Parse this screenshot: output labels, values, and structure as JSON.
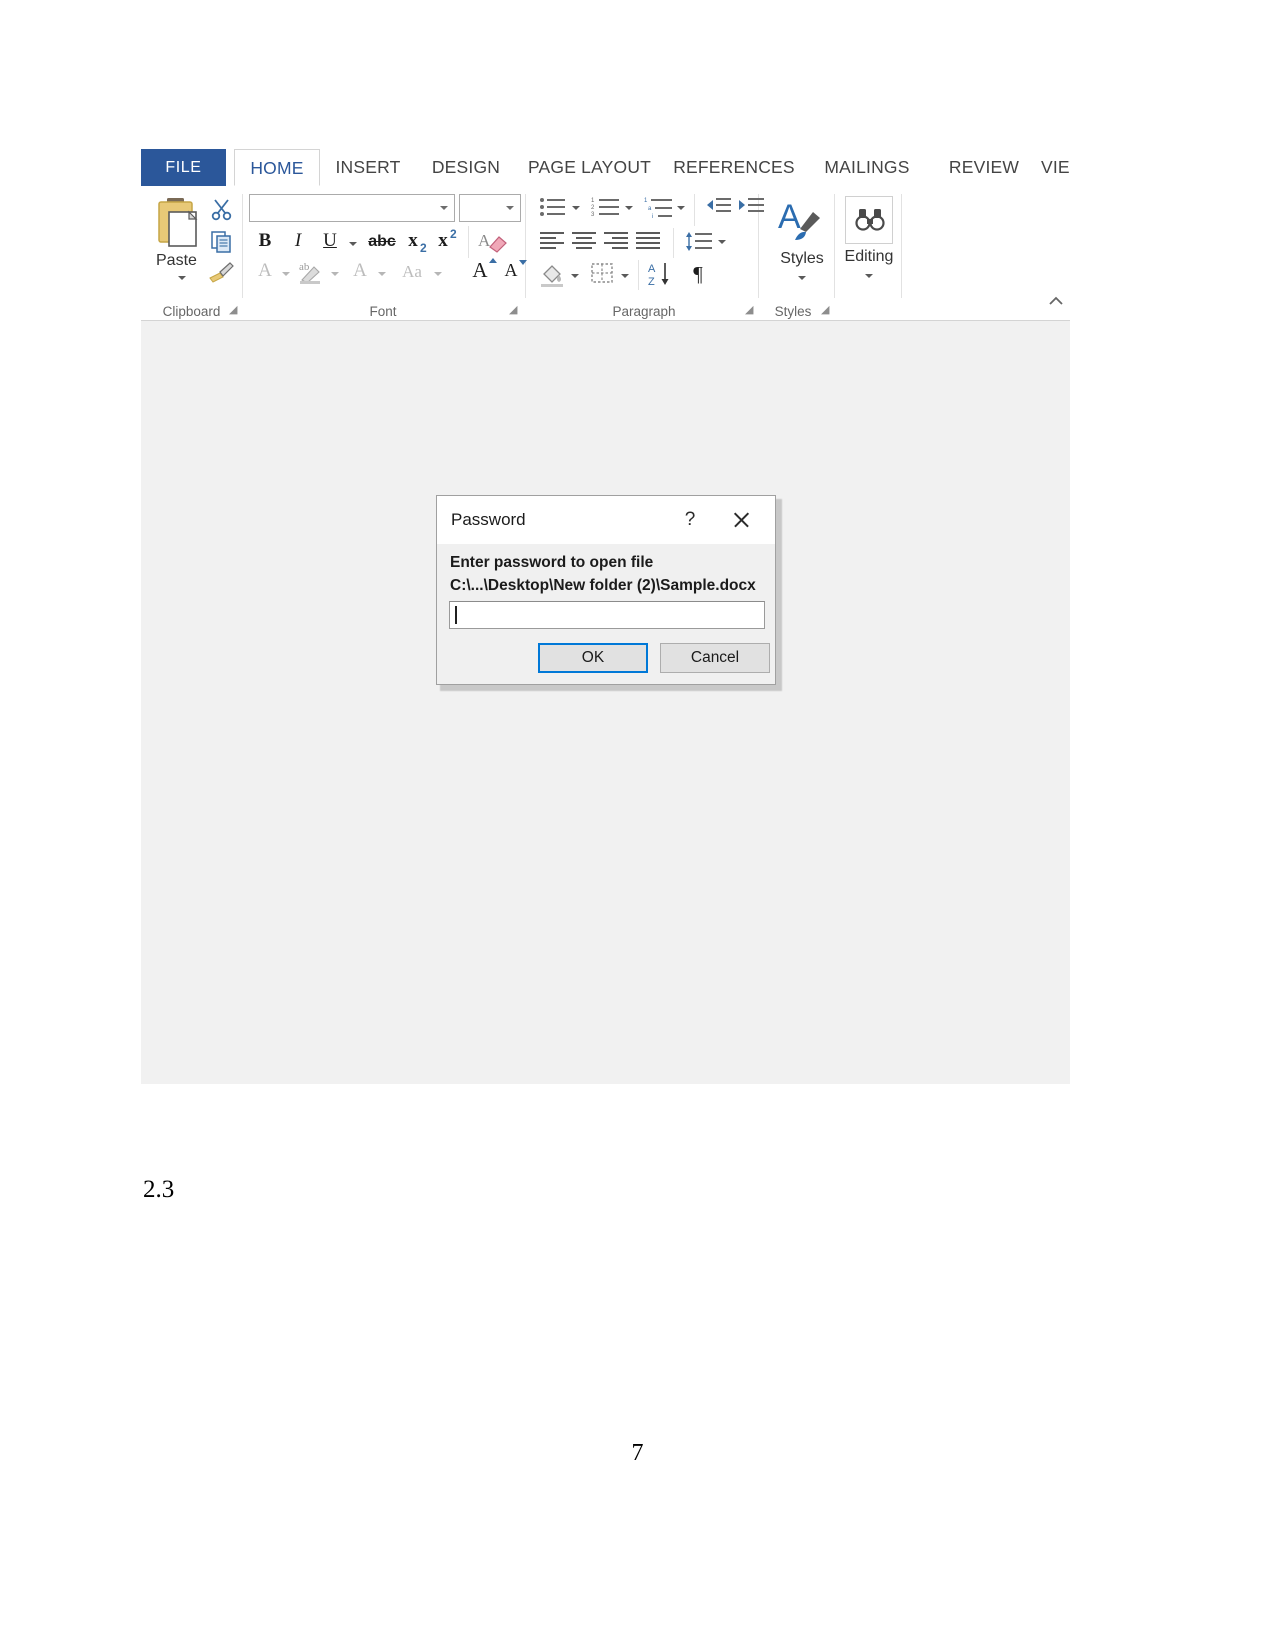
{
  "document": {
    "section_number": "2.3",
    "page_number": "7"
  },
  "word_window": {
    "tabs": [
      {
        "label": "FILE",
        "state": "file"
      },
      {
        "label": "HOME",
        "state": "active"
      },
      {
        "label": "INSERT",
        "state": "normal"
      },
      {
        "label": "DESIGN",
        "state": "normal"
      },
      {
        "label": "PAGE LAYOUT",
        "state": "normal"
      },
      {
        "label": "REFERENCES",
        "state": "normal"
      },
      {
        "label": "MAILINGS",
        "state": "normal"
      },
      {
        "label": "REVIEW",
        "state": "normal"
      },
      {
        "label": "VIEW",
        "state": "clipped"
      }
    ],
    "groups": {
      "clipboard": {
        "label": "Clipboard",
        "paste_label": "Paste"
      },
      "font": {
        "label": "Font"
      },
      "paragraph": {
        "label": "Paragraph"
      },
      "styles": {
        "label": "Styles",
        "button_label": "Styles"
      },
      "editing": {
        "label": "Editing",
        "button_label": "Editing"
      }
    },
    "font_group": {
      "font_name_value": "",
      "font_size_value": "",
      "bold": "B",
      "italic": "I",
      "underline": "U",
      "strikethrough": "abc",
      "subscript": "x",
      "subscript_sub": "2",
      "superscript": "x",
      "superscript_sup": "2",
      "text_effects": "A",
      "highlight": "ab",
      "font_color": "A",
      "change_case": "Aa",
      "grow_font": "A",
      "shrink_font": "A"
    },
    "paragraph_group": {
      "pilcrow": "¶",
      "sort_a": "A",
      "sort_z": "Z"
    },
    "colors": {
      "file_tab_blue": "#2b579a",
      "active_tab_text": "#2b579a",
      "ribbon_border": "#d4d4d4",
      "canvas_gray": "#f1f1f1",
      "focus_blue": "#0078d7"
    }
  },
  "dialog": {
    "title": "Password",
    "help_glyph": "?",
    "prompt_line1": "Enter password to open file",
    "prompt_line2": "C:\\...\\Desktop\\New folder (2)\\Sample.docx",
    "password_value": "",
    "ok_label": "OK",
    "cancel_label": "Cancel"
  }
}
